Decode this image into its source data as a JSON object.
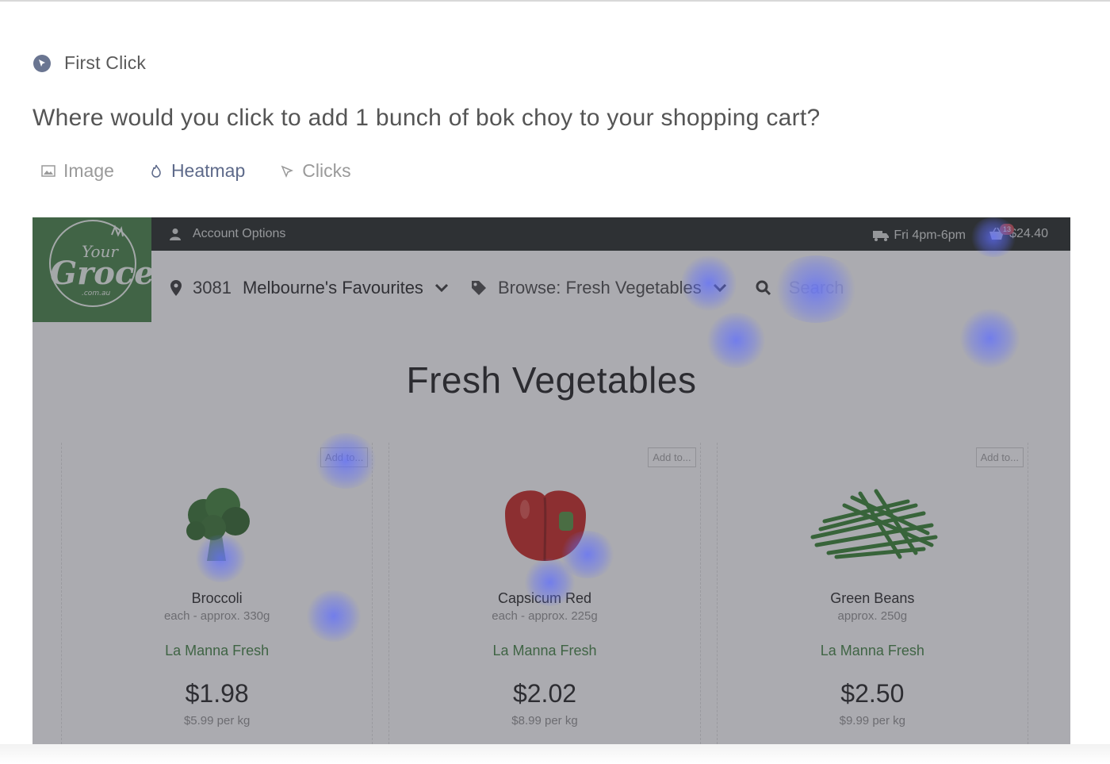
{
  "task": {
    "type_label": "First Click",
    "question": "Where would you click to add 1 bunch of bok choy to your shopping cart?"
  },
  "view_tabs": [
    {
      "label": "Image",
      "icon": "image-icon",
      "active": false
    },
    {
      "label": "Heatmap",
      "icon": "flame-icon",
      "active": true
    },
    {
      "label": "Clicks",
      "icon": "cursor-icon",
      "active": false
    }
  ],
  "site": {
    "account_label": "Account Options",
    "delivery_label": "Fri 4pm-6pm",
    "cart_badge": "13",
    "cart_total": "$24.40",
    "postcode": "3081",
    "region": "Melbourne's Favourites",
    "browse_label": "Browse: Fresh Vegetables",
    "search_placeholder": "Search",
    "page_title": "Fresh Vegetables",
    "logo_text": "Your Grocer .com.au"
  },
  "products": [
    {
      "add_label": "Add to...",
      "name": "Broccoli",
      "weight": "each - approx. 330g",
      "vendor": "La Manna Fresh",
      "price": "$1.98",
      "per_kg": "$5.99 per kg"
    },
    {
      "add_label": "Add to...",
      "name": "Capsicum Red",
      "weight": "each - approx. 225g",
      "vendor": "La Manna Fresh",
      "price": "$2.02",
      "per_kg": "$8.99 per kg"
    },
    {
      "add_label": "Add to...",
      "name": "Green Beans",
      "weight": "approx. 250g",
      "vendor": "La Manna Fresh",
      "price": "$2.50",
      "per_kg": "$9.99 per kg"
    }
  ],
  "colors": {
    "header_bg": "#1e2320",
    "logo_bg": "#3f7b3f",
    "vendor_green": "#3c7a3c",
    "heatmap_blue": "#5f6eff"
  }
}
